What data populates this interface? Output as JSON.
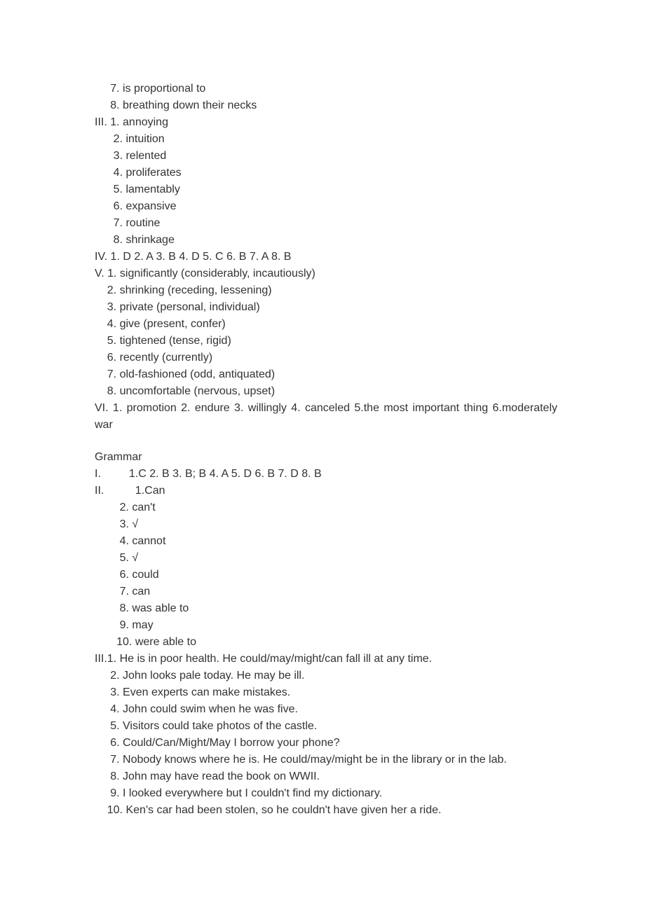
{
  "lines": [
    {
      "text": "     7. is proportional to"
    },
    {
      "text": "     8. breathing down their necks"
    },
    {
      "text": "III. 1. annoying"
    },
    {
      "text": "      2. intuition"
    },
    {
      "text": "      3. relented"
    },
    {
      "text": "      4. proliferates"
    },
    {
      "text": "      5. lamentably"
    },
    {
      "text": "      6. expansive"
    },
    {
      "text": "      7. routine"
    },
    {
      "text": "      8. shrinkage"
    },
    {
      "text": "IV. 1. D 2. A 3. B 4. D 5. C 6. B 7. A 8. B"
    },
    {
      "text": "V. 1. significantly (considerably, incautiously)"
    },
    {
      "text": "    2. shrinking (receding, lessening)"
    },
    {
      "text": "    3. private (personal, individual)"
    },
    {
      "text": "    4. give (present, confer)"
    },
    {
      "text": "    5. tightened (tense, rigid)"
    },
    {
      "text": "    6. recently (currently)"
    },
    {
      "text": "    7. old-fashioned (odd, antiquated)"
    },
    {
      "text": "    8. uncomfortable (nervous, upset)"
    },
    {
      "text": "VI. 1. promotion 2. endure 3. willingly 4. canceled 5.the most important thing 6.moderately war",
      "justify": true
    },
    {
      "gap": true
    },
    {
      "text": "Grammar"
    },
    {
      "text": "I.         1.C 2. B 3. B; B 4. A 5. D 6. B 7. D 8. B"
    },
    {
      "text": "II.          1.Can"
    },
    {
      "text": "        2. can't"
    },
    {
      "text": "        3. √"
    },
    {
      "text": "        4. cannot"
    },
    {
      "text": "        5. √"
    },
    {
      "text": "        6. could"
    },
    {
      "text": "        7. can"
    },
    {
      "text": "        8. was able to"
    },
    {
      "text": "        9. may"
    },
    {
      "text": "       10. were able to"
    },
    {
      "text": "III.1. He is in poor health. He could/may/might/can fall ill at any time."
    },
    {
      "text": "     2. John looks pale today. He may be ill."
    },
    {
      "text": "     3. Even experts can make mistakes."
    },
    {
      "text": "     4. John could swim when he was five."
    },
    {
      "text": "     5. Visitors could take photos of the castle."
    },
    {
      "text": "     6. Could/Can/Might/May I borrow your phone?"
    },
    {
      "text": "     7. Nobody knows where he is. He could/may/might be in the library or in the lab."
    },
    {
      "text": "     8. John may have read the book on WWII."
    },
    {
      "text": "     9. I looked everywhere but I couldn't find my dictionary."
    },
    {
      "text": "    10. Ken's car had been stolen, so he couldn't have given her a ride."
    }
  ]
}
